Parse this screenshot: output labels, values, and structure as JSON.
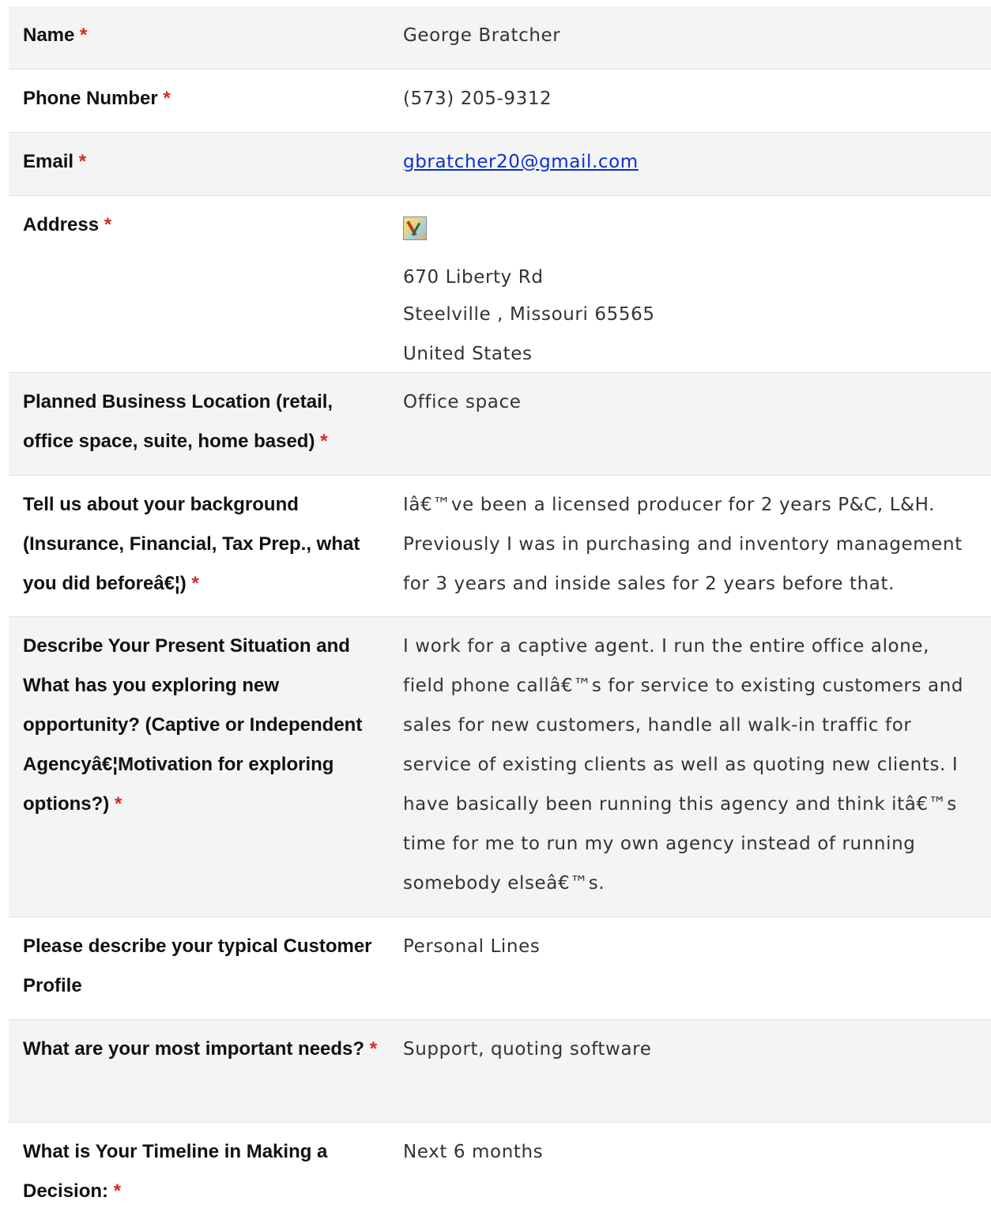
{
  "rows": [
    {
      "label": "Name",
      "required": "*",
      "value": "George Bratcher"
    },
    {
      "label": "Phone Number",
      "required": "*",
      "value": "(573) 205-9312"
    },
    {
      "label": "Email",
      "required": "*",
      "value": "gbratcher20@gmail.com"
    },
    {
      "label": "Address",
      "required": "*",
      "address": {
        "line1": "670 Liberty Rd",
        "line2": "Steelville , Missouri 65565",
        "line3": "United States"
      }
    },
    {
      "label": "Planned Business Location (retail, office space, suite, home based)",
      "required": "*",
      "value": "Office space"
    },
    {
      "label": "Tell us about your background (Insurance, Financial, Tax Prep., what you did beforeâ€¦)",
      "required": "*",
      "value": "Iâ€™ve been a licensed producer for 2 years P&C, L&H. Previously I was in purchasing and inventory management for 3 years and inside sales for 2 years before that."
    },
    {
      "label": "Describe Your Present Situation and What has you exploring new opportunity? (Captive or Independent Agencyâ€¦Motivation for exploring options?)",
      "required": "*",
      "value": "I work for a captive agent. I run the entire office alone, field phone callâ€™s for service to existing customers and sales for new customers, handle all walk-in traffic for service of existing clients as well as quoting new clients. I have basically been running this agency and think itâ€™s time for me to run my own agency instead of running somebody elseâ€™s."
    },
    {
      "label": "Please describe your typical Customer Profile",
      "required": "",
      "value": "Personal Lines"
    },
    {
      "label": "What are your most important needs?",
      "required": "*",
      "value": "Support, quoting software"
    },
    {
      "label": "What is Your Timeline in Making a Decision:",
      "required": "*",
      "value": "Next 6 months"
    }
  ],
  "icons": {
    "address_map": "map-thumbnail-icon"
  },
  "colors": {
    "row_shade": "#f4f4f4",
    "required": "#d62a1f",
    "link": "#0b2fd0"
  }
}
